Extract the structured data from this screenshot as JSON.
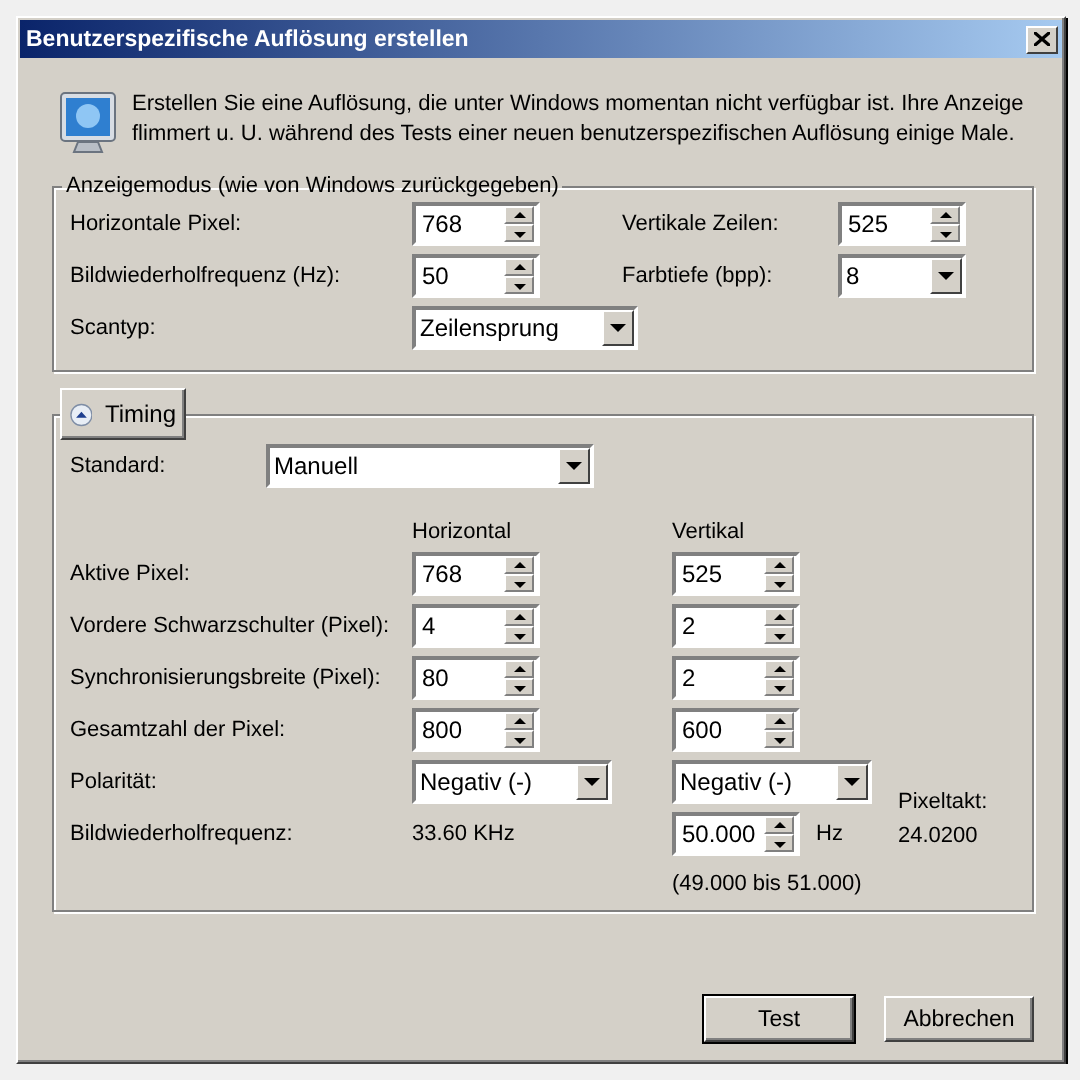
{
  "window": {
    "title": "Benutzerspezifische Auflösung erstellen"
  },
  "intro": "Erstellen Sie eine Auflösung, die unter Windows momentan nicht verfügbar ist. Ihre Anzeige flimmert u. U. während des Tests einer neuen benutzerspezifischen Auflösung einige Male.",
  "display_mode": {
    "legend": "Anzeigemodus (wie von Windows zurückgegeben)",
    "fields": [
      {
        "label": "Horizontale Pixel:",
        "kind": "spin",
        "value": "768"
      },
      {
        "label": "Vertikale Zeilen:",
        "kind": "spin",
        "value": "525"
      },
      {
        "label": "Bildwiederholfrequenz (Hz):",
        "kind": "spin",
        "value": "50"
      },
      {
        "label": "Farbtiefe (bpp):",
        "kind": "combo",
        "value": "8"
      },
      {
        "label": "Scantyp:",
        "kind": "wide_combo",
        "value": "Zeilensprung"
      }
    ]
  },
  "timing": {
    "toggle": "Timing",
    "expanded": true,
    "standard": {
      "label": "Standard:",
      "value": "Manuell"
    },
    "columns": [
      "Horizontal",
      "Vertikal"
    ],
    "rows": [
      {
        "label": "Aktive Pixel:",
        "kind": "spin",
        "horizontal": "768",
        "vertical": "525"
      },
      {
        "label": "Vordere Schwarzschulter (Pixel):",
        "kind": "spin",
        "horizontal": "4",
        "vertical": "2"
      },
      {
        "label": "Synchronisierungsbreite (Pixel):",
        "kind": "spin",
        "horizontal": "80",
        "vertical": "2"
      },
      {
        "label": "Gesamtzahl der Pixel:",
        "kind": "spin",
        "horizontal": "800",
        "vertical": "600"
      },
      {
        "label": "Polarität:",
        "kind": "combo",
        "horizontal": "Negativ (-)",
        "vertical": "Negativ (-)"
      }
    ],
    "refresh": {
      "label": "Bildwiederholfrequenz:",
      "horizontal": "33.60 KHz",
      "vertical": "50.000",
      "unit": "Hz",
      "range": "(49.000 bis 51.000)"
    },
    "pixel_clock": {
      "label": "Pixeltakt:",
      "value": "24.0200"
    }
  },
  "buttons": [
    {
      "label": "Test",
      "default": true
    },
    {
      "label": "Abbrechen",
      "default": false
    }
  ]
}
